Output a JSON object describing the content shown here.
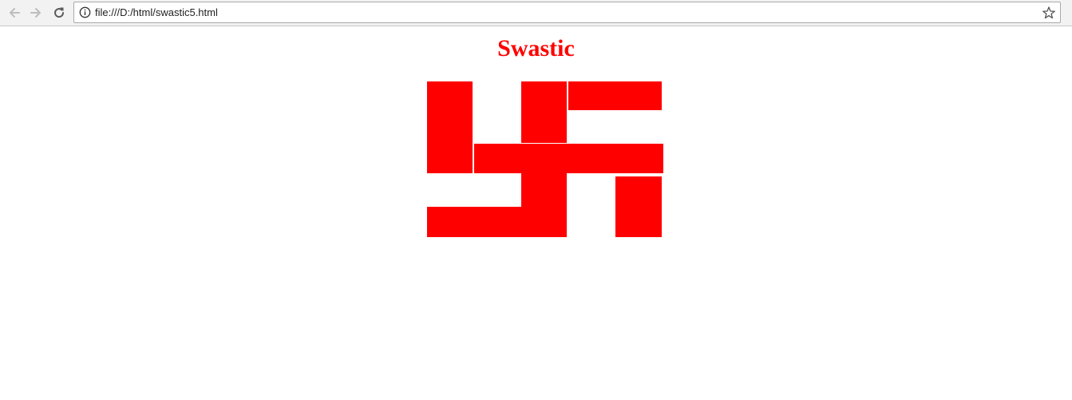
{
  "browser": {
    "url": "file:///D:/html/swastic5.html"
  },
  "page": {
    "title": "Swastic",
    "accent_color": "#ff0000"
  }
}
